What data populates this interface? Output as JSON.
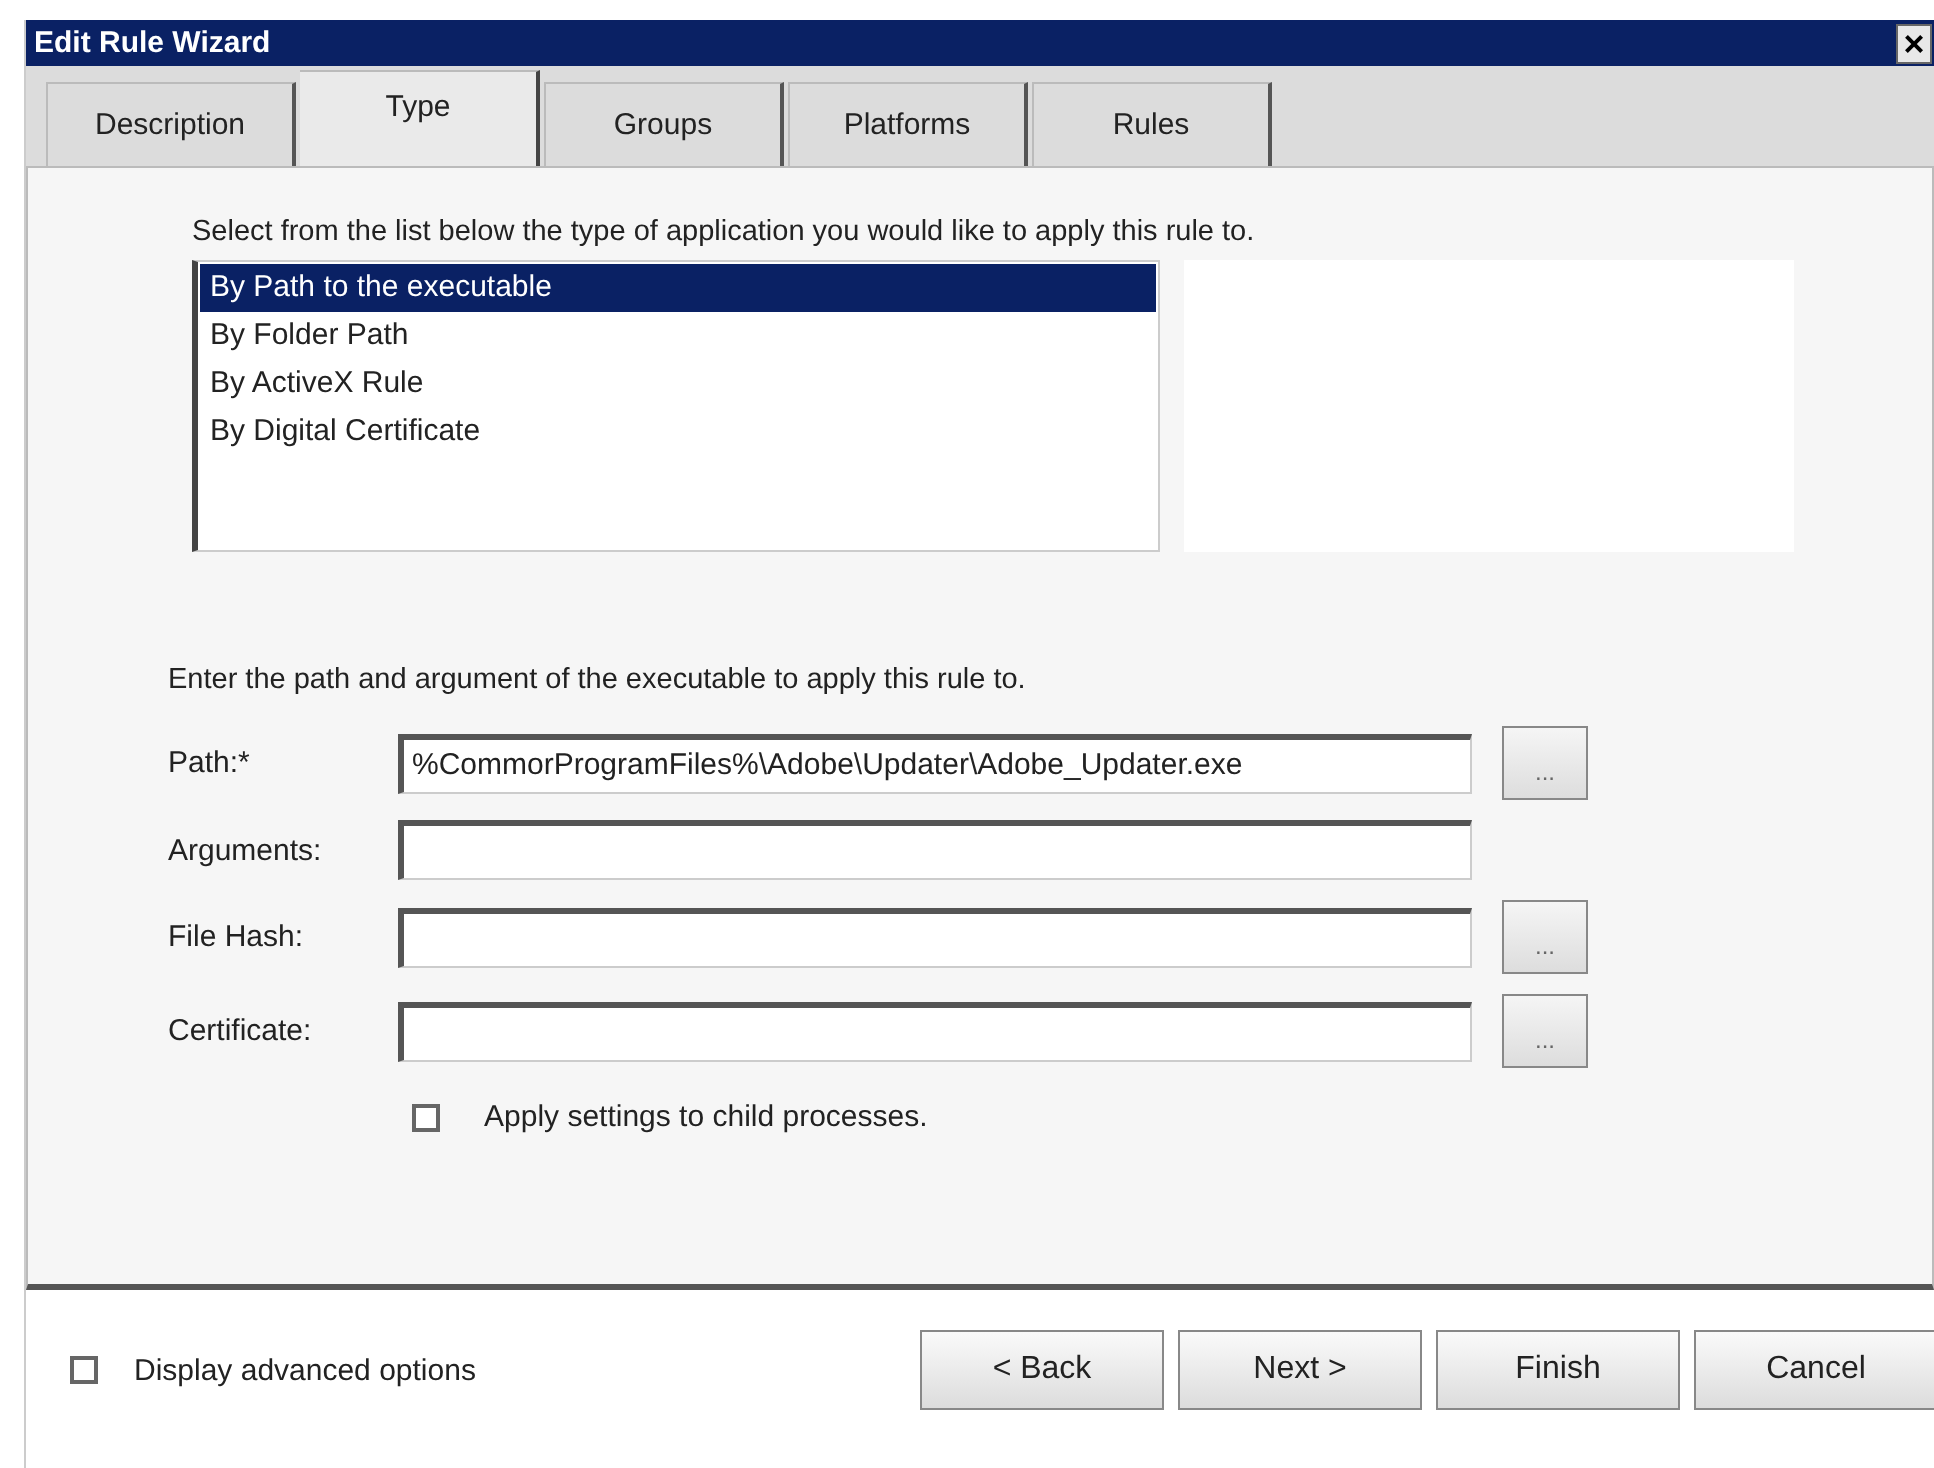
{
  "window": {
    "title": "Edit Rule Wizard",
    "close": "×"
  },
  "tabs": [
    {
      "label": "Description",
      "selected": false
    },
    {
      "label": "Type",
      "selected": true
    },
    {
      "label": "Groups",
      "selected": false
    },
    {
      "label": "Platforms",
      "selected": false
    },
    {
      "label": "Rules",
      "selected": false
    }
  ],
  "instruction": "Select from the list below the type of application you would like to apply this rule to.",
  "type_list": [
    {
      "label": "By Path to the executable",
      "selected": true
    },
    {
      "label": "By Folder Path",
      "selected": false
    },
    {
      "label": "By ActiveX Rule",
      "selected": false
    },
    {
      "label": "By Digital Certificate",
      "selected": false
    }
  ],
  "path_instruction": "Enter the path and argument of the executable to apply this rule to.",
  "fields": [
    {
      "label": "Path:*",
      "value": "%CommorProgramFiles%\\Adobe\\Updater\\Adobe_Updater.exe",
      "browse": "..."
    },
    {
      "label": "Arguments:"
    },
    {
      "label": "File Hash:",
      "browse": "..."
    },
    {
      "label": "Certificate:",
      "browse": "..."
    }
  ],
  "child_processes": {
    "label": "Apply settings to child processes.",
    "checked": false
  },
  "advanced_options": {
    "label": "Display advanced options",
    "checked": false
  },
  "buttons": [
    "< Back",
    "Next >",
    "Finish",
    "Cancel"
  ]
}
